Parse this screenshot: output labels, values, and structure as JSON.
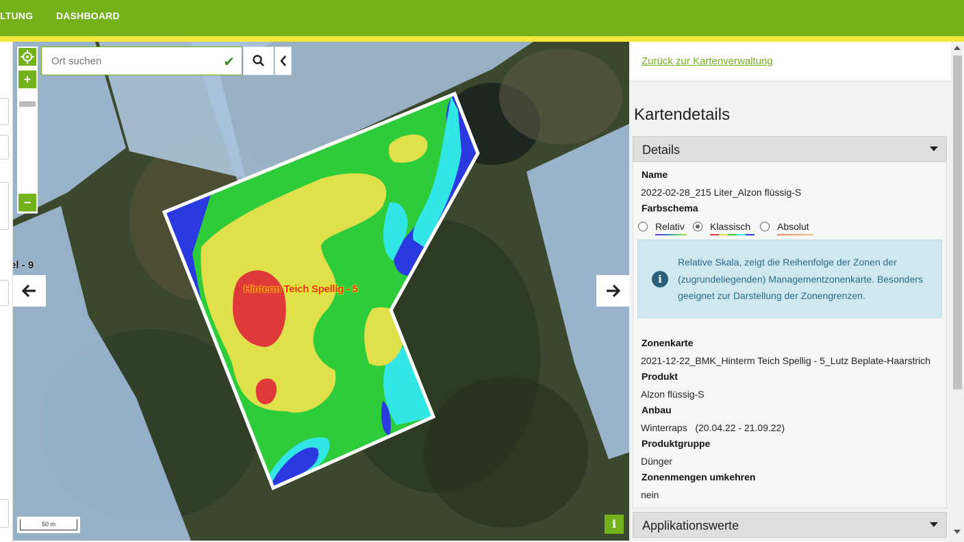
{
  "nav": {
    "item_1": "LTUNG",
    "item_2": "DASHBOARD"
  },
  "map": {
    "search_placeholder": "Ort suchen",
    "field_label": "Hinterm Teich Spellig - 5",
    "edge_label": "el - 9",
    "scale_label": "50 m",
    "zoom_in": "+",
    "zoom_out": "−",
    "info": "i"
  },
  "panel": {
    "back_link": "Zurück zur Kartenverwaltung",
    "title": "Kartendetails",
    "details_header": "Details",
    "name_label": "Name",
    "name_value": "2022-02-28_215 Liter_Alzon flüssig-S",
    "scheme_label": "Farbschema",
    "scheme_options": [
      "Relativ",
      "Klassisch",
      "Absolut"
    ],
    "scheme_selected": "Klassisch",
    "info_text": "Relative Skala, zeigt die Reihenfolge der Zonen der (zugrundeliegenden) Managementzonenkarte. Besonders geeignet zur Darstellung der Zonengrenzen.",
    "zone_label": "Zonenkarte",
    "zone_value": "2021-12-22_BMK_Hinterm Teich Spellig - 5_Lutz Beplate-Haarstrich",
    "product_label": "Produkt",
    "product_value": "Alzon flüssig-S",
    "crop_label": "Anbau",
    "crop_value": "Winterraps   (20.04.22 - 21.09.22)",
    "group_label": "Produktgruppe",
    "group_value": "Dünger",
    "invert_label": "Zonenmengen umkehren",
    "invert_value": "nein",
    "app_header": "Applikationswerte"
  },
  "colors": {
    "brand_green": "#73b21a",
    "brand_yellow": "#f5e63a",
    "zone_red": "#e0393a",
    "zone_yellow": "#dfe04a",
    "zone_green": "#2ecc3a",
    "zone_cyan": "#33e6e6",
    "zone_blue": "#2a3ae0"
  }
}
